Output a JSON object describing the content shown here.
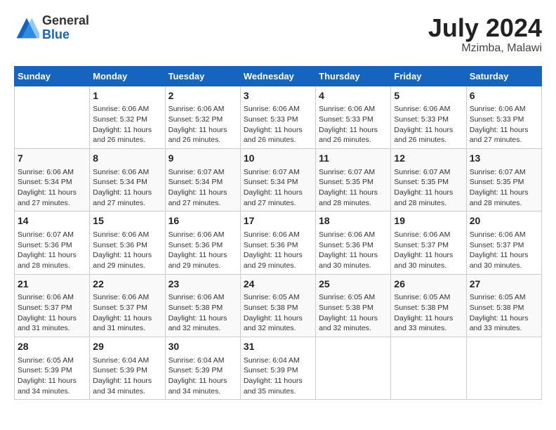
{
  "header": {
    "logo_general": "General",
    "logo_blue": "Blue",
    "title": "July 2024",
    "location": "Mzimba, Malawi"
  },
  "days_of_week": [
    "Sunday",
    "Monday",
    "Tuesday",
    "Wednesday",
    "Thursday",
    "Friday",
    "Saturday"
  ],
  "weeks": [
    [
      {
        "day": "",
        "info": ""
      },
      {
        "day": "1",
        "info": "Sunrise: 6:06 AM\nSunset: 5:32 PM\nDaylight: 11 hours\nand 26 minutes."
      },
      {
        "day": "2",
        "info": "Sunrise: 6:06 AM\nSunset: 5:32 PM\nDaylight: 11 hours\nand 26 minutes."
      },
      {
        "day": "3",
        "info": "Sunrise: 6:06 AM\nSunset: 5:33 PM\nDaylight: 11 hours\nand 26 minutes."
      },
      {
        "day": "4",
        "info": "Sunrise: 6:06 AM\nSunset: 5:33 PM\nDaylight: 11 hours\nand 26 minutes."
      },
      {
        "day": "5",
        "info": "Sunrise: 6:06 AM\nSunset: 5:33 PM\nDaylight: 11 hours\nand 26 minutes."
      },
      {
        "day": "6",
        "info": "Sunrise: 6:06 AM\nSunset: 5:33 PM\nDaylight: 11 hours\nand 27 minutes."
      }
    ],
    [
      {
        "day": "7",
        "info": ""
      },
      {
        "day": "8",
        "info": "Sunrise: 6:06 AM\nSunset: 5:34 PM\nDaylight: 11 hours\nand 27 minutes."
      },
      {
        "day": "9",
        "info": "Sunrise: 6:07 AM\nSunset: 5:34 PM\nDaylight: 11 hours\nand 27 minutes."
      },
      {
        "day": "10",
        "info": "Sunrise: 6:07 AM\nSunset: 5:34 PM\nDaylight: 11 hours\nand 27 minutes."
      },
      {
        "day": "11",
        "info": "Sunrise: 6:07 AM\nSunset: 5:35 PM\nDaylight: 11 hours\nand 28 minutes."
      },
      {
        "day": "12",
        "info": "Sunrise: 6:07 AM\nSunset: 5:35 PM\nDaylight: 11 hours\nand 28 minutes."
      },
      {
        "day": "13",
        "info": "Sunrise: 6:07 AM\nSunset: 5:35 PM\nDaylight: 11 hours\nand 28 minutes."
      }
    ],
    [
      {
        "day": "14",
        "info": ""
      },
      {
        "day": "15",
        "info": "Sunrise: 6:06 AM\nSunset: 5:36 PM\nDaylight: 11 hours\nand 29 minutes."
      },
      {
        "day": "16",
        "info": "Sunrise: 6:06 AM\nSunset: 5:36 PM\nDaylight: 11 hours\nand 29 minutes."
      },
      {
        "day": "17",
        "info": "Sunrise: 6:06 AM\nSunset: 5:36 PM\nDaylight: 11 hours\nand 29 minutes."
      },
      {
        "day": "18",
        "info": "Sunrise: 6:06 AM\nSunset: 5:36 PM\nDaylight: 11 hours\nand 30 minutes."
      },
      {
        "day": "19",
        "info": "Sunrise: 6:06 AM\nSunset: 5:37 PM\nDaylight: 11 hours\nand 30 minutes."
      },
      {
        "day": "20",
        "info": "Sunrise: 6:06 AM\nSunset: 5:37 PM\nDaylight: 11 hours\nand 30 minutes."
      }
    ],
    [
      {
        "day": "21",
        "info": ""
      },
      {
        "day": "22",
        "info": "Sunrise: 6:06 AM\nSunset: 5:37 PM\nDaylight: 11 hours\nand 31 minutes."
      },
      {
        "day": "23",
        "info": "Sunrise: 6:06 AM\nSunset: 5:38 PM\nDaylight: 11 hours\nand 32 minutes."
      },
      {
        "day": "24",
        "info": "Sunrise: 6:05 AM\nSunset: 5:38 PM\nDaylight: 11 hours\nand 32 minutes."
      },
      {
        "day": "25",
        "info": "Sunrise: 6:05 AM\nSunset: 5:38 PM\nDaylight: 11 hours\nand 32 minutes."
      },
      {
        "day": "26",
        "info": "Sunrise: 6:05 AM\nSunset: 5:38 PM\nDaylight: 11 hours\nand 33 minutes."
      },
      {
        "day": "27",
        "info": "Sunrise: 6:05 AM\nSunset: 5:38 PM\nDaylight: 11 hours\nand 33 minutes."
      }
    ],
    [
      {
        "day": "28",
        "info": ""
      },
      {
        "day": "29",
        "info": "Sunrise: 6:04 AM\nSunset: 5:39 PM\nDaylight: 11 hours\nand 34 minutes."
      },
      {
        "day": "30",
        "info": "Sunrise: 6:04 AM\nSunset: 5:39 PM\nDaylight: 11 hours\nand 34 minutes."
      },
      {
        "day": "31",
        "info": "Sunrise: 6:04 AM\nSunset: 5:39 PM\nDaylight: 11 hours\nand 35 minutes."
      },
      {
        "day": "",
        "info": ""
      },
      {
        "day": "",
        "info": ""
      },
      {
        "day": "",
        "info": ""
      }
    ]
  ],
  "week1_day7_info": "Sunrise: 6:06 AM\nSunset: 5:34 PM\nDaylight: 11 hours\nand 27 minutes.",
  "week3_day14_info": "Sunrise: 6:07 AM\nSunset: 5:36 PM\nDaylight: 11 hours\nand 28 minutes.",
  "week4_day21_info": "Sunrise: 6:06 AM\nSunset: 5:37 PM\nDaylight: 11 hours\nand 31 minutes.",
  "week5_day28_info": "Sunrise: 6:05 AM\nSunset: 5:39 PM\nDaylight: 11 hours\nand 34 minutes."
}
